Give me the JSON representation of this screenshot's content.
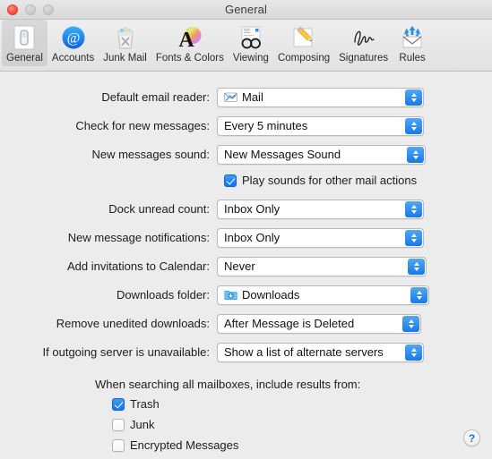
{
  "window": {
    "title": "General",
    "controls": {
      "close": "close",
      "minimize": "minimize",
      "zoom": "zoom"
    }
  },
  "toolbar": {
    "selected": "General",
    "tabs": [
      {
        "label": "General",
        "icon": "general-icon"
      },
      {
        "label": "Accounts",
        "icon": "accounts-at-icon"
      },
      {
        "label": "Junk Mail",
        "icon": "junk-mail-trash-icon"
      },
      {
        "label": "Fonts & Colors",
        "icon": "fonts-colors-icon"
      },
      {
        "label": "Viewing",
        "icon": "viewing-glasses-icon"
      },
      {
        "label": "Composing",
        "icon": "composing-pencil-icon"
      },
      {
        "label": "Signatures",
        "icon": "signatures-icon"
      },
      {
        "label": "Rules",
        "icon": "rules-envelope-icon"
      }
    ]
  },
  "form": {
    "rows": [
      {
        "label": "Default email reader:",
        "value": "Mail",
        "icon": "mail-app-icon"
      },
      {
        "label": "Check for new messages:",
        "value": "Every 5 minutes",
        "icon": null
      },
      {
        "label": "New messages sound:",
        "value": "New Messages Sound",
        "icon": null
      },
      {
        "label": "Dock unread count:",
        "value": "Inbox Only",
        "icon": null
      },
      {
        "label": "New message notifications:",
        "value": "Inbox Only",
        "icon": null
      },
      {
        "label": "Add invitations to Calendar:",
        "value": "Never",
        "icon": null
      },
      {
        "label": "Downloads folder:",
        "value": "Downloads",
        "icon": "downloads-folder-icon"
      },
      {
        "label": "Remove unedited downloads:",
        "value": "After Message is Deleted",
        "icon": null
      },
      {
        "label": "If outgoing server is unavailable:",
        "value": "Show a list of alternate servers",
        "icon": null
      }
    ],
    "play_sounds": {
      "label": "Play sounds for other mail actions",
      "checked": true
    }
  },
  "search_section": {
    "title": "When searching all mailboxes, include results from:",
    "options": [
      {
        "label": "Trash",
        "checked": true
      },
      {
        "label": "Junk",
        "checked": false
      },
      {
        "label": "Encrypted Messages",
        "checked": false
      }
    ]
  },
  "help": {
    "label": "?"
  },
  "colors": {
    "accent_blue": "#1579e8",
    "window_bg": "#ececec",
    "toolbar_bg": "#e8e8e8",
    "close_red": "#f5483b"
  }
}
